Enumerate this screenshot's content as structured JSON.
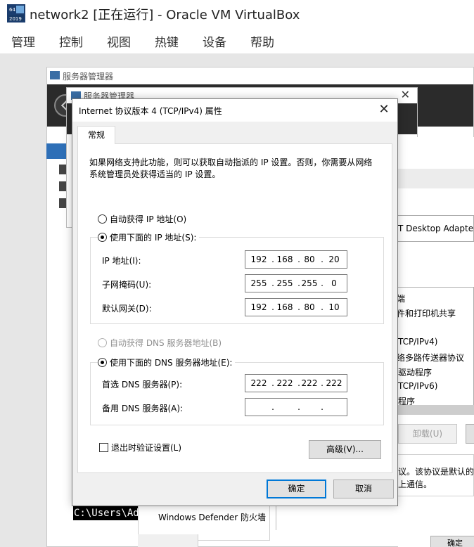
{
  "vbox": {
    "title": "network2 [正在运行] - Oracle VM VirtualBox",
    "logo_badge": "64 2019",
    "menu": [
      "管理",
      "控制",
      "视图",
      "热键",
      "设备",
      "帮助"
    ]
  },
  "server_manager_back": {
    "title": "服务器管理器"
  },
  "server_manager_mid": {
    "title": "服务器管理器",
    "close": "✕"
  },
  "adapter_props": {
    "adapter_name": "T Desktop Adapter",
    "items": [
      "端",
      "件和打印机共享",
      "TCP/IPv4)",
      "络多路传送器协议",
      "驱动程序",
      "TCP/IPv6)",
      "程序"
    ],
    "uninstall": "卸载(U)",
    "desc_line1": "议。该协议是默认的广",
    "desc_line2": "上通信。",
    "ok": "确定"
  },
  "console": {
    "text": "C:\\Users\\Adm"
  },
  "defender": {
    "label": "Windows Defender 防火墙"
  },
  "dialog": {
    "title": "Internet 协议版本 4 (TCP/IPv4) 属性",
    "close": "✕",
    "tab_general": "常规",
    "description": "如果网络支持此功能，则可以获取自动指派的 IP 设置。否则，你需要从网络系统管理员处获得适当的 IP 设置。",
    "auto_ip": "自动获得 IP 地址(O)",
    "manual_ip": "使用下面的 IP 地址(S):",
    "ip_label": "IP 地址(I):",
    "ip": [
      "192",
      "168",
      "80",
      "20"
    ],
    "mask_label": "子网掩码(U):",
    "mask": [
      "255",
      "255",
      "255",
      "0"
    ],
    "gateway_label": "默认网关(D):",
    "gateway": [
      "192",
      "168",
      "80",
      "10"
    ],
    "auto_dns": "自动获得 DNS 服务器地址(B)",
    "manual_dns": "使用下面的 DNS 服务器地址(E):",
    "preferred_dns_label": "首选 DNS 服务器(P):",
    "preferred_dns": [
      "222",
      "222",
      "222",
      "222"
    ],
    "alternate_dns_label": "备用 DNS 服务器(A):",
    "alternate_dns": [
      "",
      "",
      "",
      ""
    ],
    "validate": "退出时验证设置(L)",
    "advanced": "高级(V)...",
    "ok": "确定",
    "cancel": "取消"
  }
}
